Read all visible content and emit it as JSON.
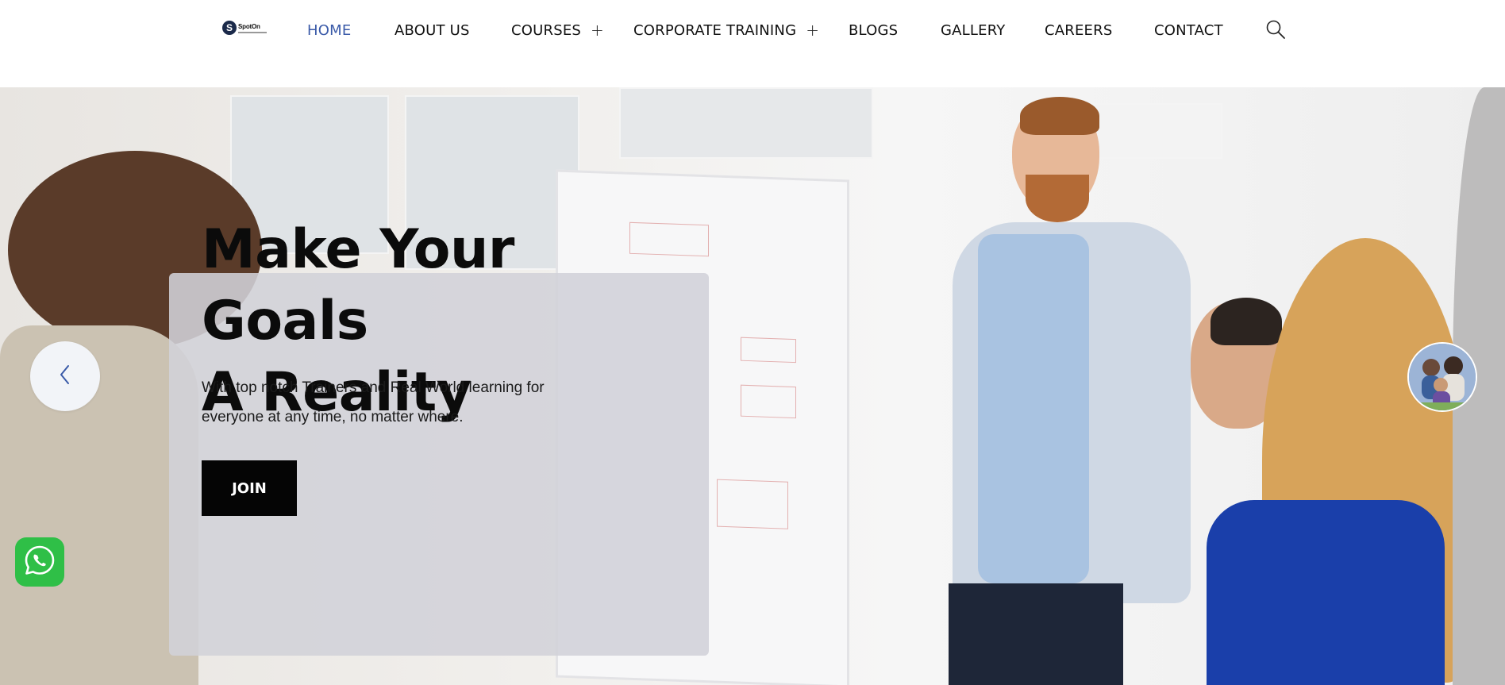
{
  "header": {
    "logo": {
      "mark": "S",
      "word": "SpotOn"
    },
    "nav": [
      {
        "label": "HOME",
        "active": true,
        "has_submenu": false
      },
      {
        "label": "ABOUT US",
        "active": false,
        "has_submenu": false
      },
      {
        "label": "COURSES",
        "active": false,
        "has_submenu": true
      },
      {
        "label": "CORPORATE TRAINING",
        "active": false,
        "has_submenu": true
      },
      {
        "label": "BLOGS",
        "active": false,
        "has_submenu": false
      },
      {
        "label": "GALLERY",
        "active": false,
        "has_submenu": false
      },
      {
        "label": "CAREERS",
        "active": false,
        "has_submenu": false
      },
      {
        "label": "CONTACT",
        "active": false,
        "has_submenu": false
      }
    ],
    "submenu_symbol": "+",
    "search_icon": "search-icon"
  },
  "hero": {
    "title_line1": "Make Your Goals",
    "title_line2": "A Reality",
    "subtitle_line1": "With top notch Trainers and Real World learning for",
    "subtitle_line2": "everyone at any time, no matter where.",
    "cta_label": "JOIN",
    "prev_icon": "chevron-left-icon"
  },
  "floating": {
    "chat_avatar_icon": "group-avatar-icon",
    "whatsapp_icon": "whatsapp-icon"
  },
  "colors": {
    "nav_active": "#3a5aa8",
    "cta_background": "#050505",
    "whatsapp": "#2fbf47",
    "caption_panel": "rgba(210,209,216,0.88)"
  }
}
